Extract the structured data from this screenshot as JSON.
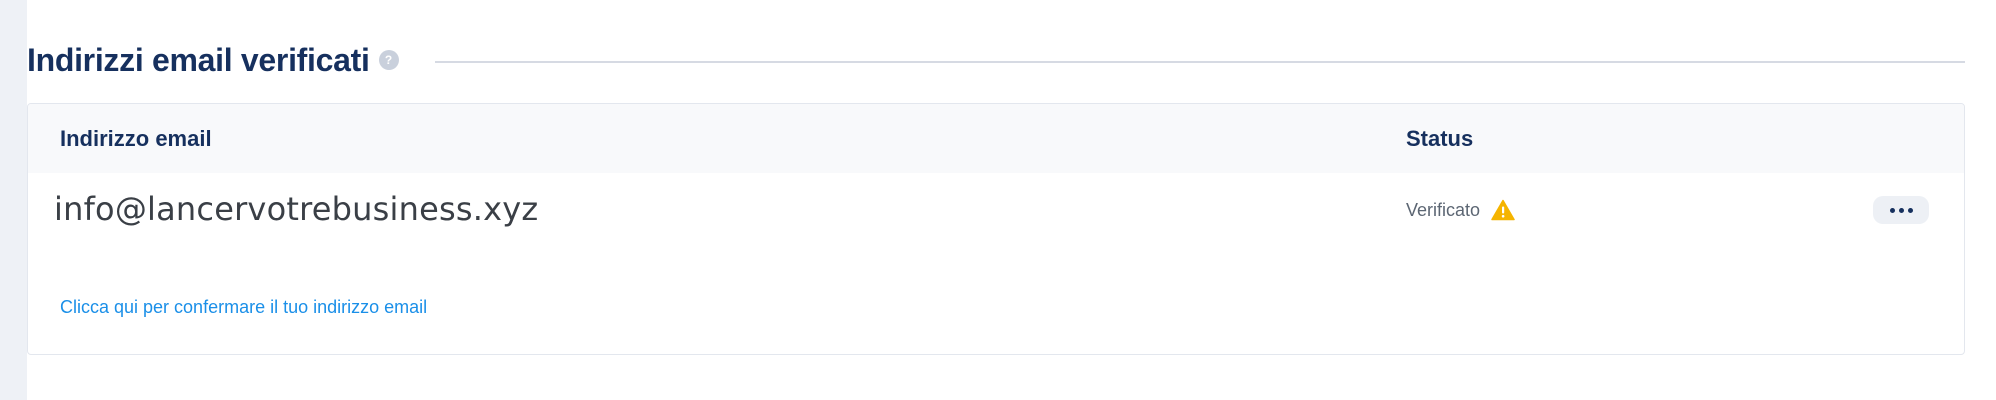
{
  "section": {
    "title": "Indirizzi email verificati",
    "help_icon_glyph": "?",
    "help_icon": "question-circle-icon"
  },
  "table": {
    "columns": {
      "email": "Indirizzo email",
      "status": "Status"
    },
    "rows": [
      {
        "email": "info@lancervotrebusiness.xyz",
        "status": "Verificato",
        "status_icon": "warning-triangle-icon",
        "actions_icon": "more-horizontal-icon"
      }
    ],
    "confirm_link": "Clicca qui per confermare il tuo indirizzo email"
  },
  "colors": {
    "heading": "#16305e",
    "link": "#1a8fe8",
    "warning": "#f5b400",
    "background": "#eef1f6"
  }
}
